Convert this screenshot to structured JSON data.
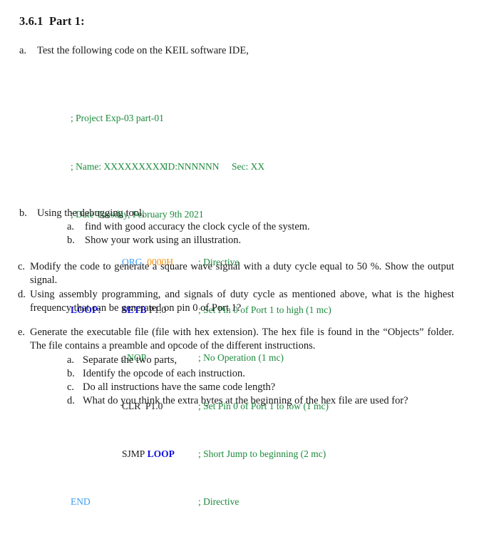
{
  "document": {
    "heading": "3.6.1  Part 1:",
    "item_a": {
      "marker": "a.",
      "text": "Test the following code on the KEIL software IDE,"
    },
    "code_block": {
      "colors": {
        "comment": "#1a8a3a",
        "directive": "#3c9ef2",
        "number": "#f2900d",
        "keyword": "#1111dd",
        "plain": "#1a1a1a"
      },
      "lines": [
        {
          "label": "",
          "instruction": "",
          "comment": "; Project Exp-03 part-01"
        },
        {
          "label": "",
          "instruction": "",
          "comment": "; Name: XXXXXXXXX",
          "id": "ID:NNNNNN",
          "section": "Sec: XX"
        },
        {
          "label": "",
          "instruction": "",
          "comment": "; Date Tuesday, February 9th 2021"
        },
        {
          "label": "",
          "op": "ORG",
          "operand": "0000H",
          "comment": "; Directive"
        },
        {
          "label": "LOOP:",
          "op": "SETB",
          "operand": "P1.0",
          "comment": "; Set Pin 0 of Port 1 to high (1 mc)"
        },
        {
          "label": "",
          "op": "; NOP",
          "operand": "",
          "comment": "; No Operation (1 mc)"
        },
        {
          "label": "",
          "op": "CLR",
          "operand": "P1.0",
          "comment": "; Set Pin 0 of Port 1 to low (1 mc)"
        },
        {
          "label": "",
          "op": "SJMP",
          "operand": "LOOP",
          "comment": "; Short Jump to beginning (2 mc)"
        },
        {
          "label": "END",
          "op": "",
          "operand": "",
          "comment": "; Directive"
        }
      ]
    },
    "item_b": {
      "marker": "b.",
      "text": "Using the debugging tool,",
      "subitems": [
        {
          "marker": "a.",
          "text": "find with good accuracy the clock cycle of the system."
        },
        {
          "marker": "b.",
          "text": "Show your work using an illustration."
        }
      ]
    },
    "item_c": {
      "marker": "c.",
      "text": "Modify the code to generate a square wave signal with a duty cycle equal to 50 %. Show the output signal."
    },
    "item_d": {
      "marker": "d.",
      "text": "Using assembly programming, and signals of duty cycle as mentioned above, what is the highest frequency that can be generated on pin 0 of Port 1?"
    },
    "item_e": {
      "marker": "e.",
      "text": "Generate the executable file (file with hex extension). The hex file is found in the “Objects” folder. The file contains a preamble and opcode of the different instructions.",
      "subitems": [
        {
          "marker": "a.",
          "text": "Separate the two parts,"
        },
        {
          "marker": "b.",
          "text": "Identify the opcode of each instruction."
        },
        {
          "marker": "c.",
          "text": "Do all instructions have the same code length?"
        },
        {
          "marker": "d.",
          "text": "What do you think the extra bytes at the beginning of the hex file are used for?"
        }
      ]
    }
  }
}
